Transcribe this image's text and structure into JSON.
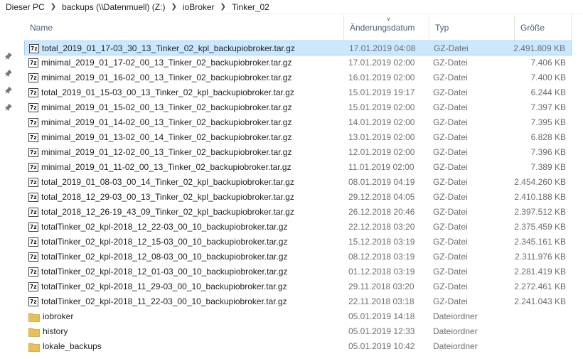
{
  "breadcrumb": [
    "Dieser PC",
    "backups (\\\\Datenmuell) (Z:)",
    "ioBroker",
    "Tinker_02"
  ],
  "columns": {
    "name": "Name",
    "date": "Änderungsdatum",
    "type": "Typ",
    "size": "Größe"
  },
  "files": [
    {
      "name": "total_2019_01_17-03_30_13_Tinker_02_kpl_backupiobroker.tar.gz",
      "date": "17.01.2019 04:08",
      "type": "GZ-Datei",
      "size": "2.491.809 KB",
      "icon": "archive-icon",
      "selected": true
    },
    {
      "name": "minimal_2019_01_17-02_00_13_Tinker_02_backupiobroker.tar.gz",
      "date": "17.01.2019 02:00",
      "type": "GZ-Datei",
      "size": "7.406 KB",
      "icon": "archive-icon"
    },
    {
      "name": "minimal_2019_01_16-02_00_13_Tinker_02_backupiobroker.tar.gz",
      "date": "16.01.2019 02:00",
      "type": "GZ-Datei",
      "size": "7.400 KB",
      "icon": "archive-icon"
    },
    {
      "name": "total_2019_01_15-03_00_13_Tinker_02_kpl_backupiobroker.tar.gz",
      "date": "15.01.2019 19:17",
      "type": "GZ-Datei",
      "size": "6.244 KB",
      "icon": "archive-icon"
    },
    {
      "name": "minimal_2019_01_15-02_00_13_Tinker_02_backupiobroker.tar.gz",
      "date": "15.01.2019 02:00",
      "type": "GZ-Datei",
      "size": "7.397 KB",
      "icon": "archive-icon"
    },
    {
      "name": "minimal_2019_01_14-02_00_13_Tinker_02_backupiobroker.tar.gz",
      "date": "14.01.2019 02:00",
      "type": "GZ-Datei",
      "size": "7.395 KB",
      "icon": "archive-icon"
    },
    {
      "name": "minimal_2019_01_13-02_00_14_Tinker_02_backupiobroker.tar.gz",
      "date": "13.01.2019 02:00",
      "type": "GZ-Datei",
      "size": "6.828 KB",
      "icon": "archive-icon"
    },
    {
      "name": "minimal_2019_01_12-02_00_13_Tinker_02_backupiobroker.tar.gz",
      "date": "12.01.2019 02:00",
      "type": "GZ-Datei",
      "size": "7.396 KB",
      "icon": "archive-icon"
    },
    {
      "name": "minimal_2019_01_11-02_00_13_Tinker_02_backupiobroker.tar.gz",
      "date": "11.01.2019 02:00",
      "type": "GZ-Datei",
      "size": "7.389 KB",
      "icon": "archive-icon"
    },
    {
      "name": "total_2019_01_08-03_00_14_Tinker_02_kpl_backupiobroker.tar.gz",
      "date": "08.01.2019 04:19",
      "type": "GZ-Datei",
      "size": "2.454.260 KB",
      "icon": "archive-icon"
    },
    {
      "name": "total_2018_12_29-03_00_13_Tinker_02_kpl_backupiobroker.tar.gz",
      "date": "29.12.2018 04:05",
      "type": "GZ-Datei",
      "size": "2.410.188 KB",
      "icon": "archive-icon"
    },
    {
      "name": "total_2018_12_26-19_43_09_Tinker_02_kpl_backupiobroker.tar.gz",
      "date": "26.12.2018 20:46",
      "type": "GZ-Datei",
      "size": "2.397.512 KB",
      "icon": "archive-icon"
    },
    {
      "name": "totalTinker_02_kpl-2018_12_22-03_00_10_backupiobroker.tar.gz",
      "date": "22.12.2018 03:20",
      "type": "GZ-Datei",
      "size": "2.375.459 KB",
      "icon": "archive-icon"
    },
    {
      "name": "totalTinker_02_kpl-2018_12_15-03_00_10_backupiobroker.tar.gz",
      "date": "15.12.2018 03:19",
      "type": "GZ-Datei",
      "size": "2.345.161 KB",
      "icon": "archive-icon"
    },
    {
      "name": "totalTinker_02_kpl-2018_12_08-03_00_10_backupiobroker.tar.gz",
      "date": "08.12.2018 03:19",
      "type": "GZ-Datei",
      "size": "2.311.976 KB",
      "icon": "archive-icon"
    },
    {
      "name": "totalTinker_02_kpl-2018_12_01-03_00_10_backupiobroker.tar.gz",
      "date": "01.12.2018 03:19",
      "type": "GZ-Datei",
      "size": "2.281.419 KB",
      "icon": "archive-icon"
    },
    {
      "name": "totalTinker_02_kpl-2018_11_29-03_00_10_backupiobroker.tar.gz",
      "date": "29.11.2018 03:20",
      "type": "GZ-Datei",
      "size": "2.272.461 KB",
      "icon": "archive-icon"
    },
    {
      "name": "totalTinker_02_kpl-2018_11_22-03_00_10_backupiobroker.tar.gz",
      "date": "22.11.2018 03:18",
      "type": "GZ-Datei",
      "size": "2.241.043 KB",
      "icon": "archive-icon"
    },
    {
      "name": "iobroker",
      "date": "05.01.2019 14:18",
      "type": "Dateiordner",
      "size": "",
      "icon": "folder-icon"
    },
    {
      "name": "history",
      "date": "05.01.2019 12:33",
      "type": "Dateiordner",
      "size": "",
      "icon": "folder-icon"
    },
    {
      "name": "lokale_backups",
      "date": "05.01.2019 10:42",
      "type": "Dateiordner",
      "size": "",
      "icon": "folder-icon"
    }
  ],
  "nav_pins": [
    "pin-icon",
    "pin-icon",
    "pin-icon",
    "pin-icon"
  ],
  "archive_icon_glyph": "7z",
  "colors": {
    "selection": "#cce8ff",
    "selection_border": "#99d1ff",
    "header_text": "#4c607a",
    "folder": "#e8c05a"
  }
}
